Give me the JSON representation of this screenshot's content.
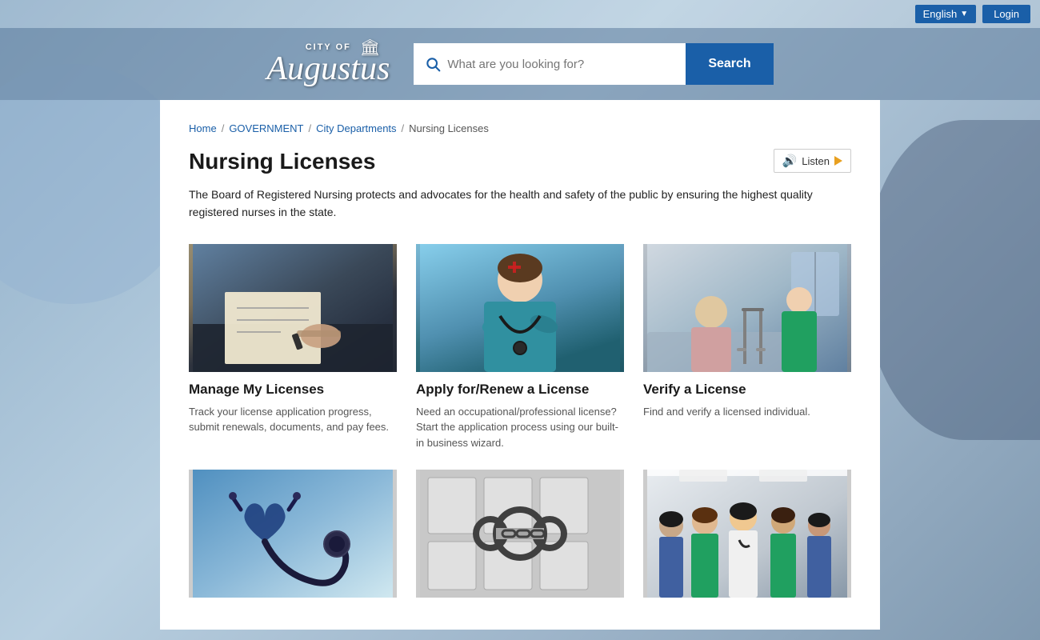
{
  "topbar": {
    "language_label": "English",
    "language_dropdown_icon": "chevron-down",
    "login_label": "Login"
  },
  "header": {
    "logo_city_of": "CITY OF",
    "logo_name": "Augustus",
    "logo_icon": "🏛",
    "search_placeholder": "What are you looking for?",
    "search_button_label": "Search"
  },
  "breadcrumb": {
    "items": [
      {
        "label": "Home",
        "link": true
      },
      {
        "label": "GOVERNMENT",
        "link": true
      },
      {
        "label": "City Departments",
        "link": true
      },
      {
        "label": "Nursing Licenses",
        "link": false
      }
    ],
    "separator": "/"
  },
  "page": {
    "title": "Nursing Licenses",
    "listen_label": "Listen",
    "description": "The Board of Registered Nursing protects and advocates for the health and safety of the public by ensuring the highest quality registered nurses in the state.",
    "cards": [
      {
        "id": "manage",
        "title": "Manage My Licenses",
        "description": "Track your license application progress, submit renewals, documents, and pay fees.",
        "image_type": "writing"
      },
      {
        "id": "apply",
        "title": "Apply for/Renew a License",
        "description": "Need an occupational/professional license? Start the application process using our built-in business wizard.",
        "image_type": "nurse"
      },
      {
        "id": "verify",
        "title": "Verify a License",
        "description": "Find and verify a licensed individual.",
        "image_type": "elderly"
      },
      {
        "id": "resources",
        "title": "",
        "description": "",
        "image_type": "stethoscope"
      },
      {
        "id": "enforcement",
        "title": "",
        "description": "",
        "image_type": "handcuffs"
      },
      {
        "id": "education",
        "title": "",
        "description": "",
        "image_type": "group"
      }
    ]
  },
  "colors": {
    "primary_blue": "#1a5fa8",
    "orange": "#e8a020",
    "text_dark": "#1a1a1a",
    "text_muted": "#555555"
  }
}
